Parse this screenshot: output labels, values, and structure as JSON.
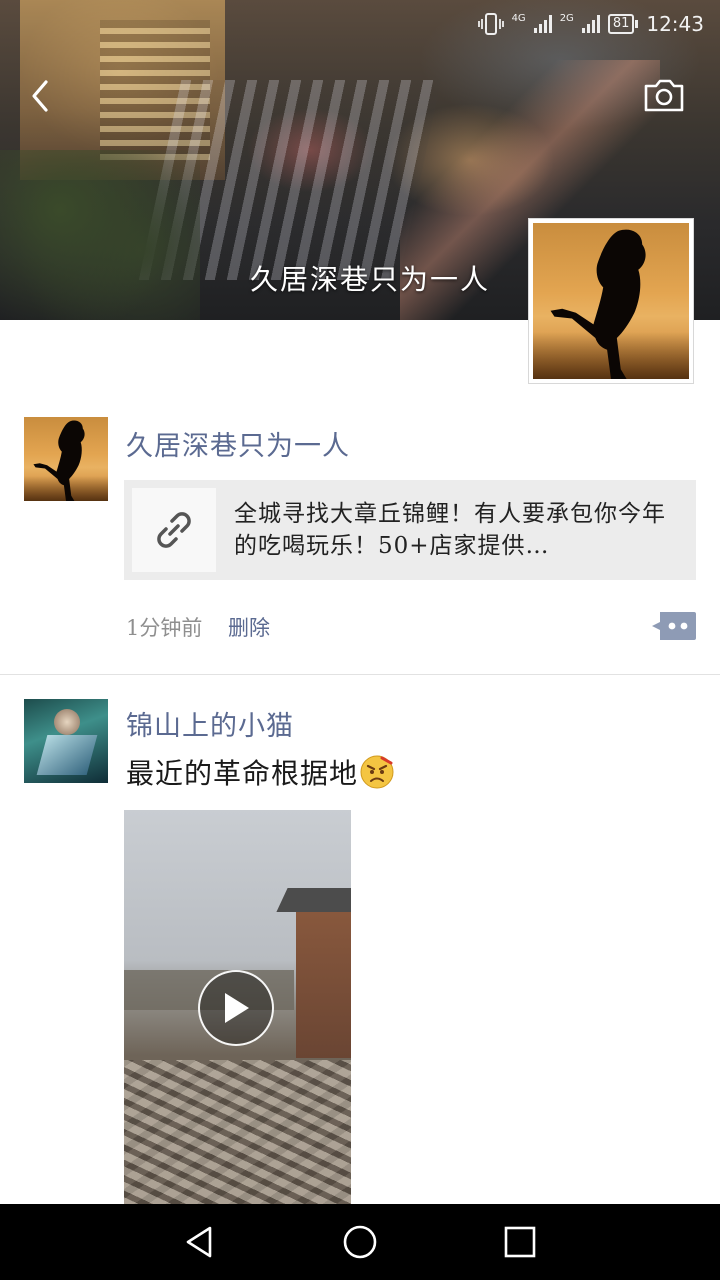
{
  "status_bar": {
    "net_left": "4G",
    "net_right": "2G",
    "battery": "81",
    "time": "12:43"
  },
  "cover": {
    "title": "久居深巷只为一人"
  },
  "posts": [
    {
      "nickname": "久居深巷只为一人",
      "link_title": "全城寻找大章丘锦鲤！有人要承包你今年的吃喝玩乐！50+店家提供…",
      "time": "1分钟前",
      "delete_label": "删除"
    },
    {
      "nickname": "锦山上的小猫",
      "text": "最近的革命根据地"
    }
  ],
  "colors": {
    "nickname": "#5b6a91",
    "link_card_bg": "#ececec",
    "navbar_bg": "#000000"
  },
  "icons": {
    "back": "chevron-left-icon",
    "camera": "camera-icon",
    "link": "link-icon",
    "more": "comment-more-icon",
    "play": "play-icon",
    "nav_back": "triangle-back-icon",
    "nav_home": "circle-home-icon",
    "nav_recent": "square-recent-icon"
  }
}
